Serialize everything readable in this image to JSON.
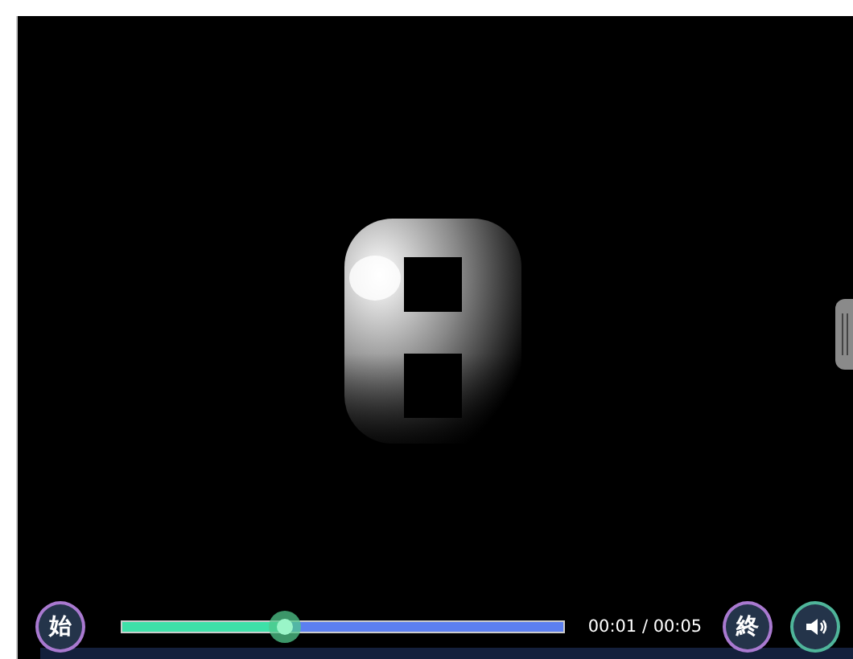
{
  "controls": {
    "start_button": "始",
    "progress": {
      "level": 0.37
    },
    "time": "00:01 / 00:05",
    "end_button": "終"
  }
}
